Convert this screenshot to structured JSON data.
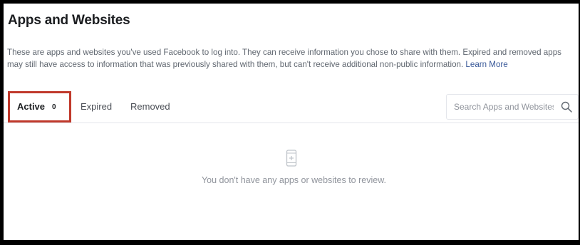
{
  "page": {
    "title": "Apps and Websites",
    "description": "These are apps and websites you've used Facebook to log into. They can receive information you chose to share with them. Expired and removed apps may still have access to information that was previously shared with them, but can't receive additional non-public information.",
    "learn_more": "Learn More"
  },
  "tabs": [
    {
      "label": "Active",
      "count": "0",
      "selected": true
    },
    {
      "label": "Expired"
    },
    {
      "label": "Removed"
    }
  ],
  "search": {
    "placeholder": "Search Apps and Websites",
    "value": "",
    "icon": "search-icon"
  },
  "empty_state": {
    "icon": "mobile-app-icon",
    "message": "You don't have any apps or websites to review."
  },
  "colors": {
    "highlight_border": "#c0392b",
    "link": "#385898",
    "frame": "#000000"
  }
}
